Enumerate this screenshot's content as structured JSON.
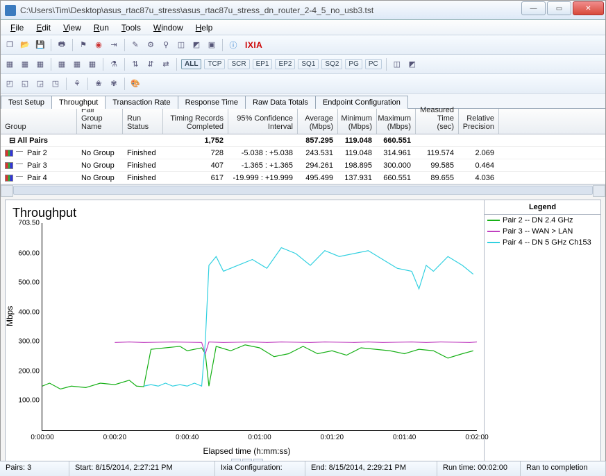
{
  "title": "C:\\Users\\Tim\\Desktop\\asus_rtac87u_stress\\asus_rtac87u_stress_dn_router_2-4_5_no_usb3.tst",
  "menus": [
    "File",
    "Edit",
    "View",
    "Run",
    "Tools",
    "Window",
    "Help"
  ],
  "brand": "IXIA",
  "filterbar": {
    "all": "ALL",
    "items": [
      "TCP",
      "SCR",
      "EP1",
      "EP2",
      "SQ1",
      "SQ2",
      "PG",
      "PC"
    ]
  },
  "tabs": [
    "Test Setup",
    "Throughput",
    "Transaction Rate",
    "Response Time",
    "Raw Data Totals",
    "Endpoint Configuration"
  ],
  "active_tab": 1,
  "columns": [
    "Group",
    "Pair Group Name",
    "Run Status",
    "Timing Records Completed",
    "95% Confidence Interval",
    "Average (Mbps)",
    "Minimum (Mbps)",
    "Maximum (Mbps)",
    "Measured Time (sec)",
    "Relative Precision"
  ],
  "summary": {
    "label": "All Pairs",
    "timing": "1,752",
    "avg": "857.295",
    "min": "119.048",
    "max": "660.551"
  },
  "rows": [
    {
      "pair": "Pair 2",
      "pgn": "No Group",
      "status": "Finished",
      "tr": "728",
      "ci": "-5.038 : +5.038",
      "avg": "243.531",
      "min": "119.048",
      "max": "314.961",
      "mt": "119.574",
      "rp": "2.069"
    },
    {
      "pair": "Pair 3",
      "pgn": "No Group",
      "status": "Finished",
      "tr": "407",
      "ci": "-1.365 : +1.365",
      "avg": "294.261",
      "min": "198.895",
      "max": "300.000",
      "mt": "99.585",
      "rp": "0.464"
    },
    {
      "pair": "Pair 4",
      "pgn": "No Group",
      "status": "Finished",
      "tr": "617",
      "ci": "-19.999 : +19.999",
      "avg": "495.499",
      "min": "137.931",
      "max": "660.551",
      "mt": "89.655",
      "rp": "4.036"
    }
  ],
  "chart_data": {
    "type": "line",
    "title": "Throughput",
    "ylabel": "Mbps",
    "xlabel": "Elapsed time (h:mm:ss)",
    "ylim": [
      0,
      703.5
    ],
    "yticks": [
      100,
      200,
      300,
      400,
      500,
      600,
      703.5
    ],
    "yticklabels": [
      "100.00",
      "200.00",
      "300.00",
      "400.00",
      "500.00",
      "600.00",
      "703.50"
    ],
    "xticks": [
      0,
      20,
      40,
      60,
      80,
      100,
      120
    ],
    "xticklabels": [
      "0:00:00",
      "0:00:20",
      "0:00:40",
      "0:01:00",
      "0:01:20",
      "0:01:40",
      "0:02:00"
    ],
    "legend_title": "Legend",
    "series": [
      {
        "name": "Pair 2 -- DN 2.4 GHz",
        "color": "#16b016",
        "x": [
          0,
          2,
          5,
          8,
          12,
          16,
          20,
          24,
          26,
          28,
          30,
          34,
          38,
          40,
          44,
          45,
          46,
          48,
          52,
          56,
          60,
          64,
          68,
          72,
          76,
          80,
          84,
          88,
          92,
          96,
          100,
          104,
          108,
          112,
          116,
          119
        ],
        "y": [
          150,
          160,
          140,
          150,
          145,
          160,
          155,
          170,
          150,
          148,
          275,
          280,
          285,
          270,
          280,
          260,
          150,
          285,
          270,
          290,
          280,
          250,
          260,
          285,
          260,
          270,
          255,
          280,
          275,
          270,
          260,
          275,
          270,
          245,
          260,
          270
        ]
      },
      {
        "name": "Pair 3 -- WAN > LAN",
        "color": "#c040c0",
        "x": [
          20,
          24,
          28,
          32,
          36,
          40,
          44,
          45,
          46,
          50,
          54,
          58,
          62,
          66,
          70,
          74,
          78,
          82,
          86,
          90,
          94,
          98,
          102,
          106,
          110,
          114,
          118,
          120
        ],
        "y": [
          298,
          300,
          298,
          299,
          300,
          299,
          298,
          260,
          300,
          298,
          299,
          300,
          298,
          300,
          299,
          298,
          300,
          299,
          298,
          300,
          298,
          299,
          300,
          298,
          300,
          299,
          298,
          300
        ]
      },
      {
        "name": "Pair 4 -- DN 5 GHz Ch153",
        "color": "#30d0e0",
        "x": [
          28,
          30,
          32,
          34,
          36,
          38,
          40,
          42,
          44,
          45,
          46,
          48,
          50,
          54,
          58,
          62,
          66,
          70,
          74,
          78,
          82,
          86,
          90,
          94,
          98,
          102,
          104,
          106,
          108,
          112,
          116,
          119
        ],
        "y": [
          150,
          155,
          150,
          160,
          150,
          155,
          150,
          160,
          150,
          300,
          560,
          590,
          540,
          560,
          580,
          550,
          620,
          600,
          560,
          610,
          590,
          600,
          610,
          580,
          550,
          540,
          480,
          560,
          540,
          590,
          560,
          530
        ]
      }
    ]
  },
  "status": {
    "pairs": "Pairs: 3",
    "start": "Start: 8/15/2014, 2:27:21 PM",
    "config": "Ixia Configuration:",
    "end": "End: 8/15/2014, 2:29:21 PM",
    "runtime": "Run time: 00:02:00",
    "result": "Ran to completion"
  }
}
